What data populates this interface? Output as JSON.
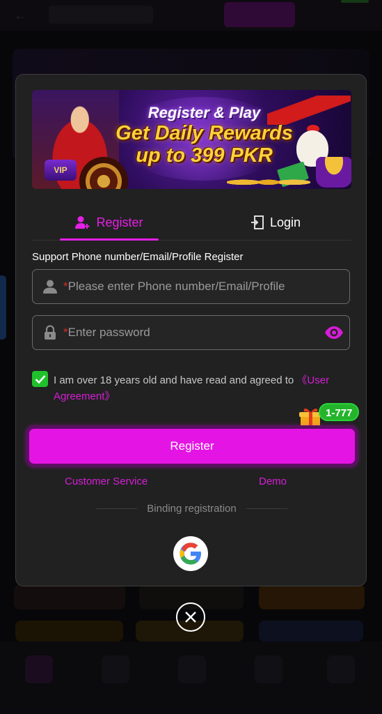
{
  "banner": {
    "line1": "Register & Play",
    "line2": "Get Daily Rewards",
    "line3": "up to 399 PKR",
    "vip": "VIP"
  },
  "tabs": [
    {
      "label": "Register",
      "icon": "user-add-icon",
      "active": true
    },
    {
      "label": "Login",
      "icon": "login-door-icon",
      "active": false
    }
  ],
  "form": {
    "support_label": "Support Phone number/Email/Profile Register",
    "account_field": {
      "required_mark": "*",
      "placeholder": "Please enter Phone number/Email/Profile",
      "value": "",
      "icon": "user-icon"
    },
    "password_field": {
      "required_mark": "*",
      "placeholder": "Enter password",
      "value": "",
      "icon": "lock-icon",
      "toggle_icon": "eye-icon"
    },
    "agreement": {
      "checked": true,
      "text": "I am over 18 years old and have read and agreed to ",
      "link": "《User Agreement》"
    },
    "bonus_badge": "1-777",
    "submit_label": "Register"
  },
  "links": {
    "customer_service": "Customer Service",
    "demo": "Demo"
  },
  "binding": {
    "label": "Binding registration",
    "providers": [
      "google-icon"
    ]
  },
  "colors": {
    "accent": "#e414e4",
    "check_green": "#1fc22c",
    "modal_bg": "#212121"
  }
}
